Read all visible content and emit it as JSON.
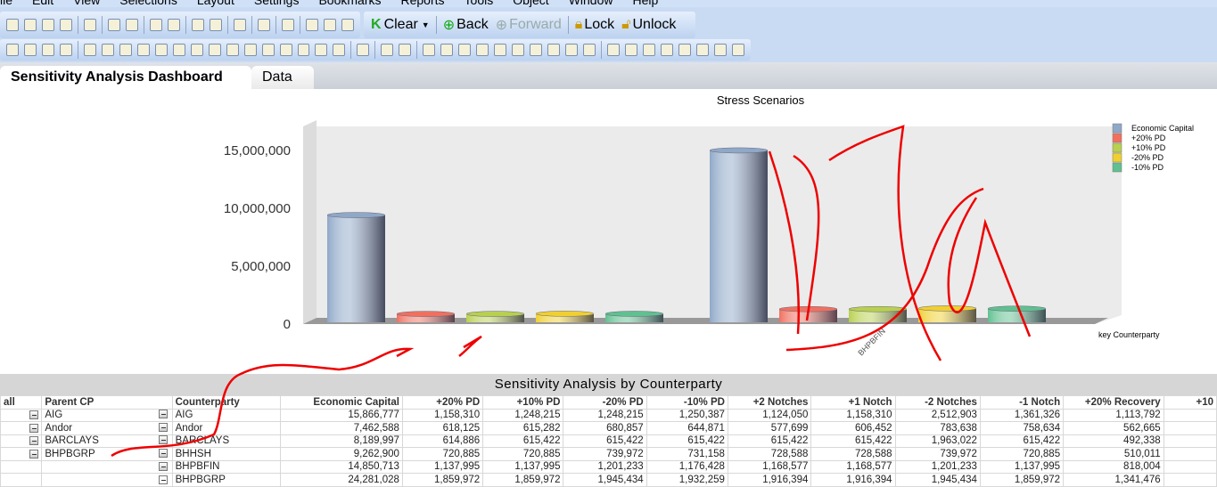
{
  "menu": [
    "ile",
    "Edit",
    "View",
    "Selections",
    "Layout",
    "Settings",
    "Bookmarks",
    "Reports",
    "Tools",
    "Object",
    "Window",
    "Help"
  ],
  "toolbar": {
    "clear": "Clear",
    "back": "Back",
    "forward": "Forward",
    "lock": "Lock",
    "unlock": "Unlock"
  },
  "tabs": [
    {
      "label": "Sensitivity Analysis Dashboard",
      "active": true
    },
    {
      "label": "Data",
      "active": false
    }
  ],
  "colors": {
    "economic_capital": "#8fa8c8",
    "pd20": "#f07060",
    "pd10": "#b8d050",
    "m20": "#f0d030",
    "m10": "#60c090"
  },
  "chart_data": {
    "type": "bar",
    "title": "Stress Scenarios",
    "xlabel": "key Counterparty",
    "categories": [
      "",
      "BHPBFIN"
    ],
    "series": [
      {
        "name": "Economic Capital",
        "values": [
          9262900,
          14850713
        ]
      },
      {
        "name": "+20% PD",
        "values": [
          720885,
          1137995
        ]
      },
      {
        "name": "+10% PD",
        "values": [
          720885,
          1137995
        ]
      },
      {
        "name": "-20% PD",
        "values": [
          739972,
          1201233
        ]
      },
      {
        "name": "-10% PD",
        "values": [
          731158,
          1176428
        ]
      }
    ],
    "yticks": [
      "0",
      "5,000,000",
      "10,000,000",
      "15,000,000"
    ],
    "ylim": [
      0,
      17500000
    ],
    "legend": "right"
  },
  "table": {
    "title": "Sensitivity Analysis by Counterparty",
    "headers": [
      "all",
      "Parent CP",
      "Counterparty",
      "Economic Capital",
      "+20% PD",
      "+10% PD",
      "-20% PD",
      "-10% PD",
      "+2 Notches",
      "+1 Notch",
      "-2 Notches",
      "-1 Notch",
      "+20% Recovery",
      "+10"
    ],
    "rows": [
      [
        "",
        "AIG",
        "AIG",
        "15,866,777",
        "1,158,310",
        "1,248,215",
        "1,248,215",
        "1,250,387",
        "1,124,050",
        "1,158,310",
        "2,512,903",
        "1,361,326",
        "1,113,792",
        ""
      ],
      [
        "",
        "Andor",
        "Andor",
        "7,462,588",
        "618,125",
        "615,282",
        "680,857",
        "644,871",
        "577,699",
        "606,452",
        "783,638",
        "758,634",
        "562,665",
        ""
      ],
      [
        "",
        "BARCLAYS",
        "BARCLAYS",
        "8,189,997",
        "614,886",
        "615,422",
        "615,422",
        "615,422",
        "615,422",
        "615,422",
        "1,963,022",
        "615,422",
        "492,338",
        ""
      ],
      [
        "",
        "BHPBGRP",
        "BHHSH",
        "9,262,900",
        "720,885",
        "720,885",
        "739,972",
        "731,158",
        "728,588",
        "728,588",
        "739,972",
        "720,885",
        "510,011",
        ""
      ],
      [
        "",
        "",
        "BHPBFIN",
        "14,850,713",
        "1,137,995",
        "1,137,995",
        "1,201,233",
        "1,176,428",
        "1,168,577",
        "1,168,577",
        "1,201,233",
        "1,137,995",
        "818,004",
        ""
      ],
      [
        "",
        "",
        "BHPBGRP",
        "24,281,028",
        "1,859,972",
        "1,859,972",
        "1,945,434",
        "1,932,259",
        "1,916,394",
        "1,916,394",
        "1,945,434",
        "1,859,972",
        "1,341,476",
        ""
      ]
    ]
  }
}
